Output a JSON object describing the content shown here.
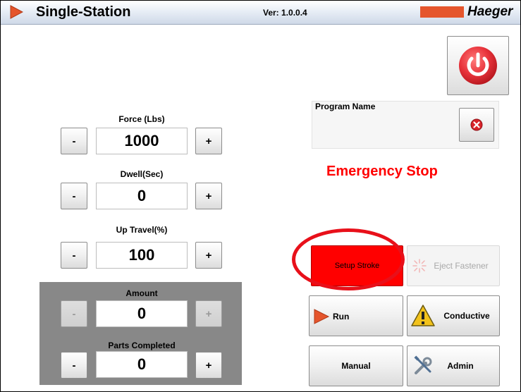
{
  "window": {
    "app_title": "Single-Station",
    "version": "Ver: 1.0.0.4",
    "brand": "Haeger"
  },
  "controls": {
    "force": {
      "label": "Force (Lbs)",
      "value": "1000",
      "minus": "-",
      "plus": "+"
    },
    "dwell": {
      "label": "Dwell(Sec)",
      "value": "0",
      "minus": "-",
      "plus": "+"
    },
    "up_travel": {
      "label": "Up Travel(%)",
      "value": "100",
      "minus": "-",
      "plus": "+"
    },
    "amount": {
      "label": "Amount",
      "value": "0",
      "minus": "-",
      "plus": "+"
    },
    "parts_completed": {
      "label": "Parts Completed",
      "value": "0",
      "minus": "-",
      "plus": "+"
    }
  },
  "program": {
    "label": "Program Name",
    "value": ""
  },
  "status": {
    "emergency_stop": "Emergency Stop"
  },
  "actions": {
    "setup_stroke": "Setup Stroke",
    "eject_fastener": "Eject Fastener",
    "run": "Run",
    "conductive": "Conductive",
    "manual": "Manual",
    "admin": "Admin"
  },
  "colors": {
    "title_gradient_bottom": "#cfd9e8",
    "brand_bar": "#e5552c",
    "emergency_text": "#ff0000",
    "setup_button": "#ff0000",
    "power_button": "#e8333b",
    "gray_panel": "#888888",
    "highlight_ring": "#e8101a"
  },
  "icons": {
    "app": "play-arrow-icon",
    "power": "power-icon",
    "clear": "close-circle-icon",
    "run": "play-arrow-icon",
    "conductive": "warning-icon",
    "admin": "tools-icon",
    "eject": "spark-icon"
  }
}
